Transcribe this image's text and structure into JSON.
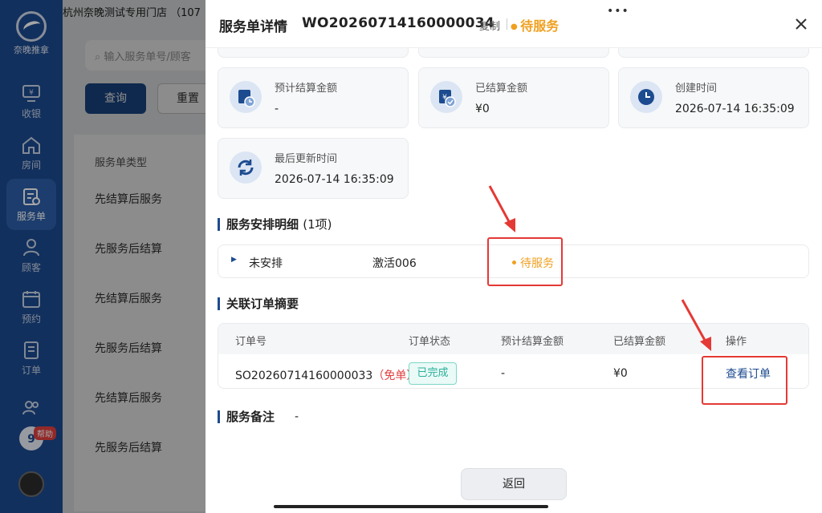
{
  "sidebar": {
    "logo_text": "奈晚推拿",
    "items": [
      {
        "label": "收银",
        "icon": "cashier-icon"
      },
      {
        "label": "房间",
        "icon": "home-icon"
      },
      {
        "label": "服务单",
        "icon": "service-order-icon"
      },
      {
        "label": "顾客",
        "icon": "user-icon"
      },
      {
        "label": "预约",
        "icon": "calendar-icon"
      },
      {
        "label": "订单",
        "icon": "order-icon"
      },
      {
        "label": "",
        "icon": "users-icon"
      }
    ],
    "help_label": "帮助"
  },
  "background": {
    "store_title": "杭州奈晚测试专用门店 （107",
    "search_placeholder": "输入服务单号/顾客",
    "query_label": "查询",
    "reset_label": "重置",
    "table_header": "服务单类型",
    "rows": [
      "先结算后服务",
      "先服务后结算",
      "先结算后服务",
      "先服务后结算",
      "先结算后服务",
      "先服务后结算"
    ]
  },
  "drawer": {
    "title": "服务单详情",
    "order_no": "WO20260714160000034",
    "copy_label": "复制",
    "status": "待服务",
    "cards": [
      {
        "label": "预计结算金额",
        "value": "-",
        "icon": "estimate-settlement-icon"
      },
      {
        "label": "已结算金额",
        "value": "¥0",
        "icon": "settled-amount-icon"
      },
      {
        "label": "创建时间",
        "value": "2026-07-14 16:35:09",
        "icon": "clock-icon"
      },
      {
        "label": "最后更新时间",
        "value": "2026-07-14 16:35:09",
        "icon": "refresh-icon"
      }
    ],
    "arrangement": {
      "title": "服务安排明细",
      "count": "(1项)",
      "row": {
        "name": "未安排",
        "project": "激活006",
        "status": "待服务"
      }
    },
    "orders": {
      "title": "关联订单摘要",
      "headers": [
        "订单号",
        "订单状态",
        "预计结算金额",
        "已结算金额",
        "操作"
      ],
      "row": {
        "order_no": "SO20260714160000033",
        "tag": "（免单）",
        "status": "已完成",
        "estimate": "-",
        "settled": "¥0",
        "action": "查看订单"
      }
    },
    "remark": {
      "title": "服务备注",
      "value": "-"
    },
    "back_label": "返回"
  },
  "colors": {
    "primary": "#1d4b8f",
    "warning": "#f0a020",
    "success": "#2ab09a",
    "danger": "#e04040",
    "annotation": "#e53935"
  }
}
